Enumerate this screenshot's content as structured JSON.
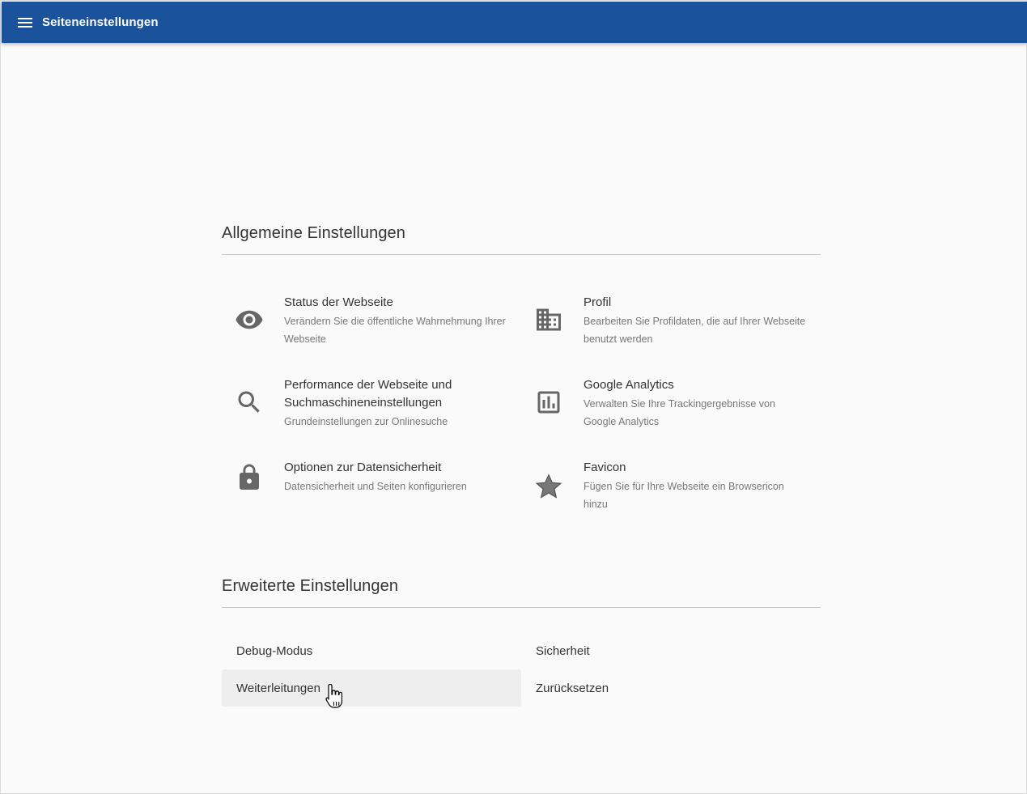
{
  "appbar": {
    "title": "Seiteneinstellungen",
    "menu_icon": "hamburger-menu-icon",
    "color": "#1a529b"
  },
  "general": {
    "title": "Allgemeine Einstellungen",
    "items": [
      {
        "title": "Status der Webseite",
        "description": "Verändern Sie die öffentliche Wahrnehmung Ihrer Webseite",
        "icon": "eye-icon"
      },
      {
        "title": "Profil",
        "description": "Bearbeiten Sie Profildaten, die auf Ihrer Webseite benutzt werden",
        "icon": "building-icon"
      },
      {
        "title": "Performance der Webseite und Suchmaschineneinstellungen",
        "description": "Grundeinstellungen zur Onlinesuche",
        "icon": "search-icon"
      },
      {
        "title": "Google Analytics",
        "description": "Verwalten Sie Ihre Trackingergebnisse von Google Analytics",
        "icon": "bar-chart-icon"
      },
      {
        "title": "Optionen zur Datensicherheit",
        "description": "Datensicherheit und Seiten konfigurieren",
        "icon": "lock-icon"
      },
      {
        "title": "Favicon",
        "description": "Fügen Sie für Ihre Webseite ein Browsericon hinzu",
        "icon": "star-icon"
      }
    ]
  },
  "advanced": {
    "title": "Erweiterte Einstellungen",
    "items": [
      {
        "label": "Debug-Modus"
      },
      {
        "label": "Sicherheit"
      },
      {
        "label": "Weiterleitungen"
      },
      {
        "label": "Zurücksetzen"
      }
    ]
  },
  "colors": {
    "icon": "#666666",
    "text": "#333333",
    "secondary_text": "#777777",
    "hover_background": "#eeeeee"
  }
}
